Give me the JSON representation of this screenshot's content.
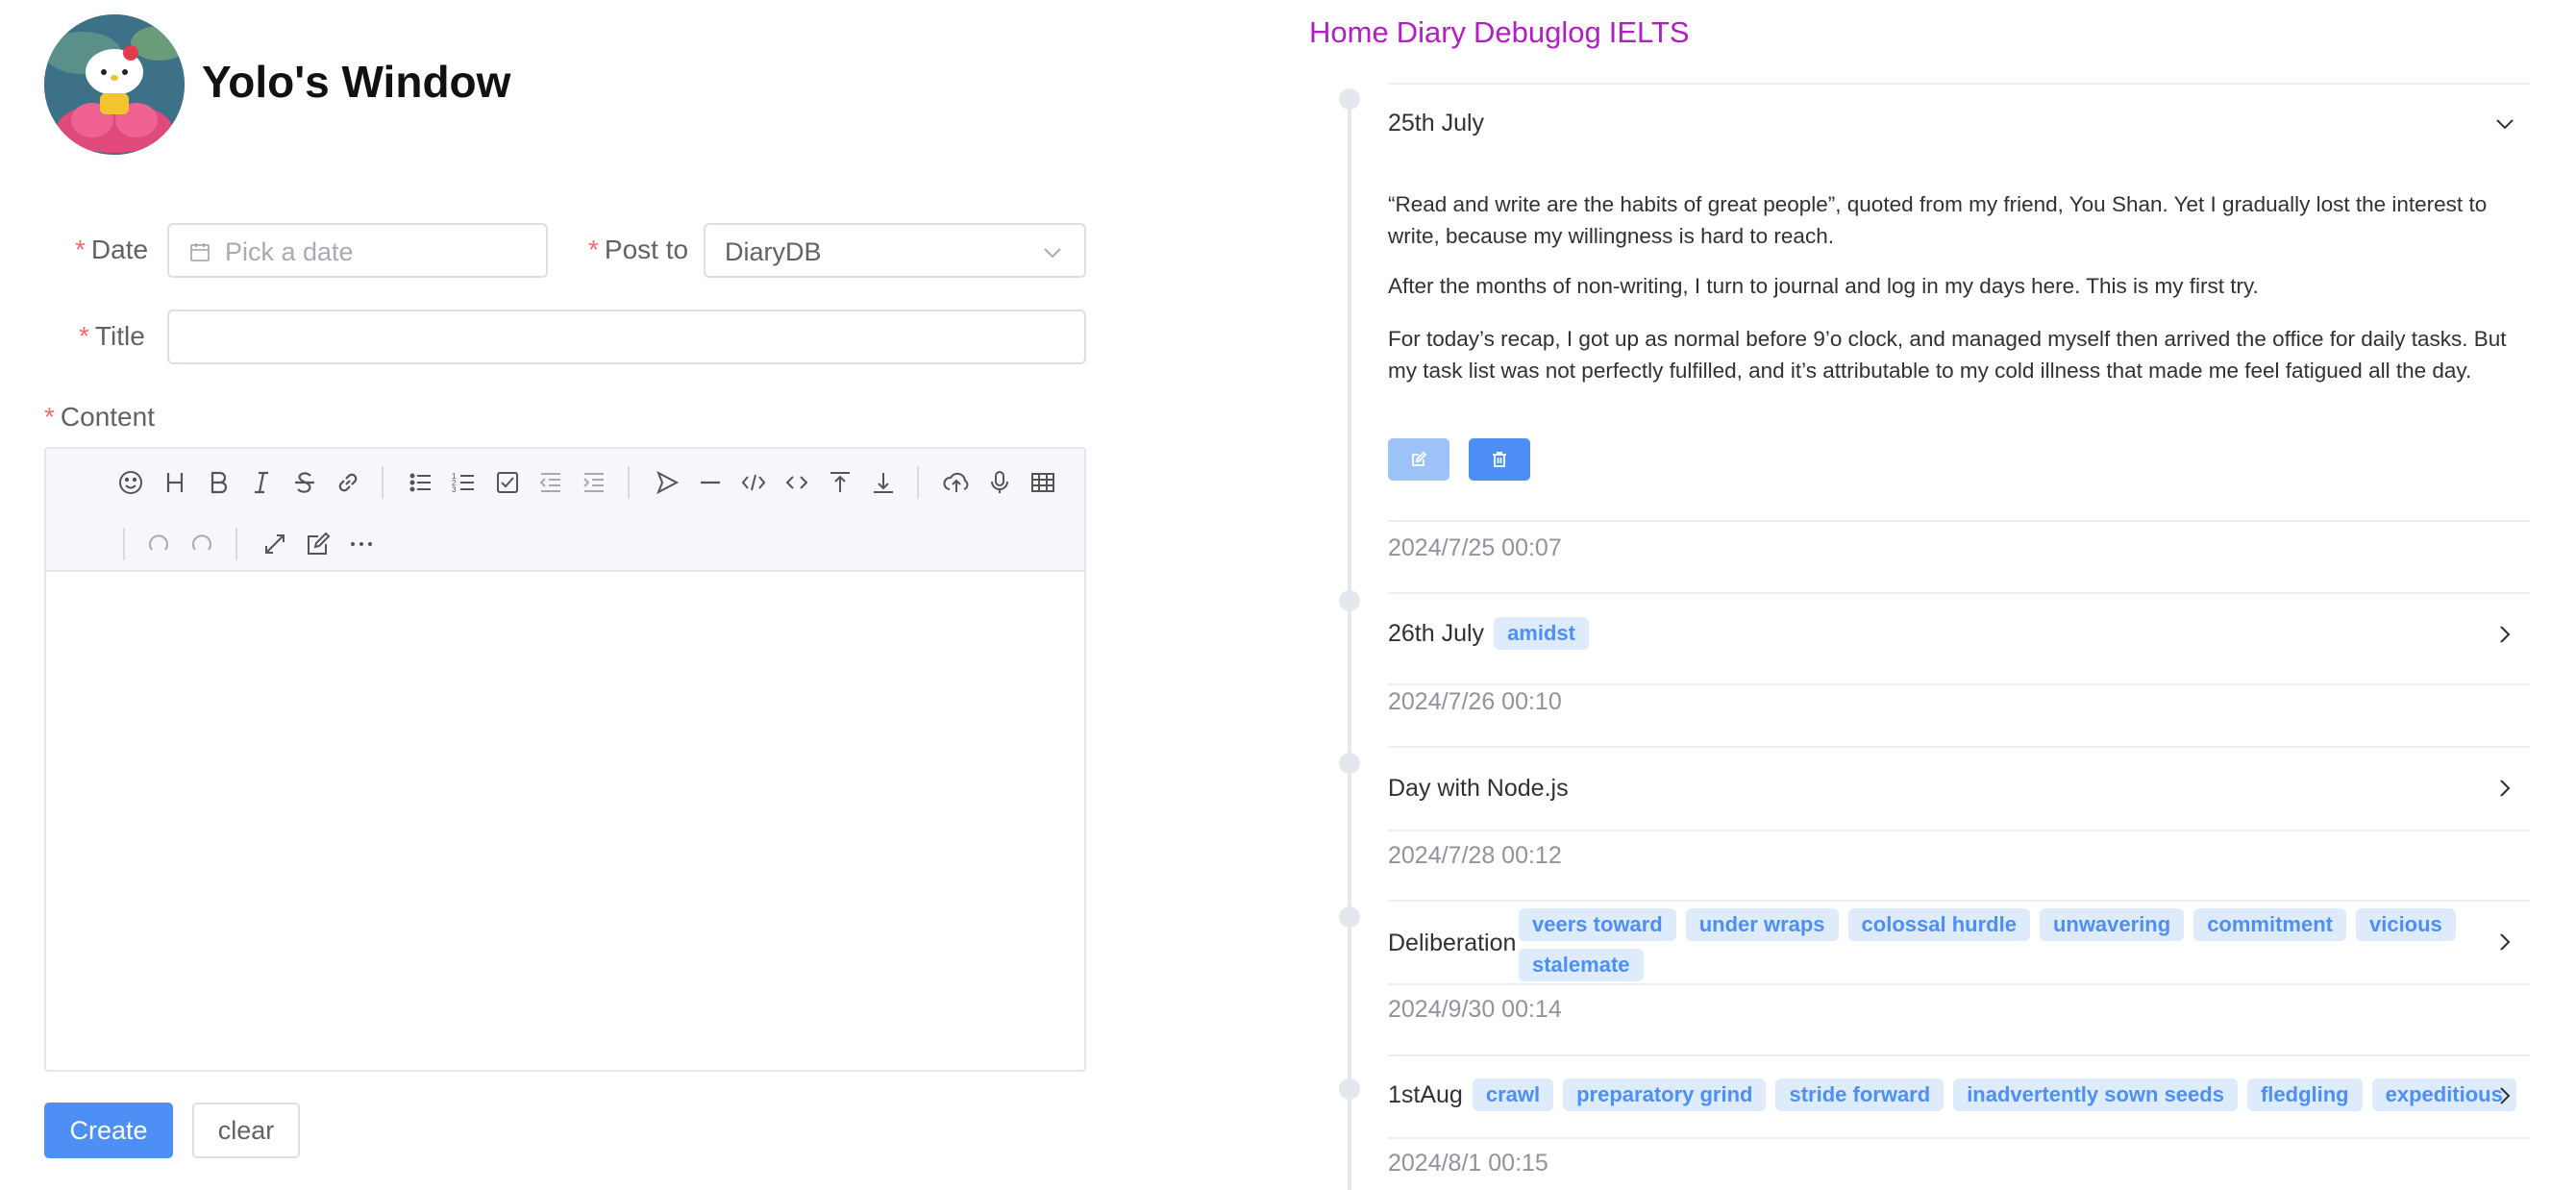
{
  "site": {
    "title": "Yolo's Window"
  },
  "form": {
    "date_label": "Date",
    "date_placeholder": "Pick a date",
    "post_to_label": "Post to",
    "post_to_value": "DiaryDB",
    "title_label": "Title",
    "content_label": "Content",
    "required_mark": "*"
  },
  "toolbar": {
    "row1": [
      "emoji-icon",
      "header-icon",
      "bold-icon",
      "italic-icon",
      "strike-icon",
      "link-icon",
      "unordered-list-icon",
      "ordered-list-icon",
      "check-icon",
      "outdent-icon",
      "indent-icon",
      "quote-icon",
      "line-icon",
      "code-icon",
      "inline-code-icon",
      "insert-before-icon",
      "insert-after-icon",
      "upload-icon",
      "record-icon",
      "table-icon"
    ],
    "row2": [
      "undo-icon",
      "redo-icon",
      "fullscreen-icon",
      "edit-mode-icon",
      "more-icon"
    ]
  },
  "buttons": {
    "create": "Create",
    "clear": "clear"
  },
  "nav": {
    "items": [
      "Home",
      "Diary",
      "Debuglog",
      "IELTS"
    ]
  },
  "entries": [
    {
      "title": "25th July",
      "tags": [],
      "expanded": true,
      "paragraphs": [
        "“Read and write are the habits of great people”, quoted from my friend, You Shan. Yet I gradually lost the interest to write, because my willingness is hard to reach.",
        "After the months of non-writing, I turn to journal and log in my days here. This is my first try.",
        "For today’s recap, I got up as normal before 9’o clock, and managed myself then arrived the office for daily tasks. But my task list was not perfectly fulfilled, and it’s attributable to my cold illness that made me feel fatigued all the day."
      ],
      "timestamp": "2024/7/25 00:07"
    },
    {
      "title": "26th July",
      "tags": [
        "amidst"
      ],
      "timestamp": "2024/7/26 00:10"
    },
    {
      "title": "Day with Node.js",
      "tags": [],
      "timestamp": "2024/7/28 00:12"
    },
    {
      "title": "Deliberation",
      "tags": [
        "veers toward",
        "under wraps",
        "colossal hurdle",
        "unwavering",
        "commitment",
        "vicious",
        "stalemate"
      ],
      "timestamp": "2024/9/30 00:14"
    },
    {
      "title": "1stAug",
      "tags": [
        "crawl",
        "preparatory grind",
        "stride forward",
        "inadvertently sown seeds",
        "fledgling",
        "expeditious"
      ],
      "timestamp": "2024/8/1 00:15"
    }
  ],
  "colors": {
    "accent": "#4d8ff5",
    "nav": "#b01ec4",
    "tag_bg": "#ddebfb",
    "required": "#f56c6c"
  }
}
